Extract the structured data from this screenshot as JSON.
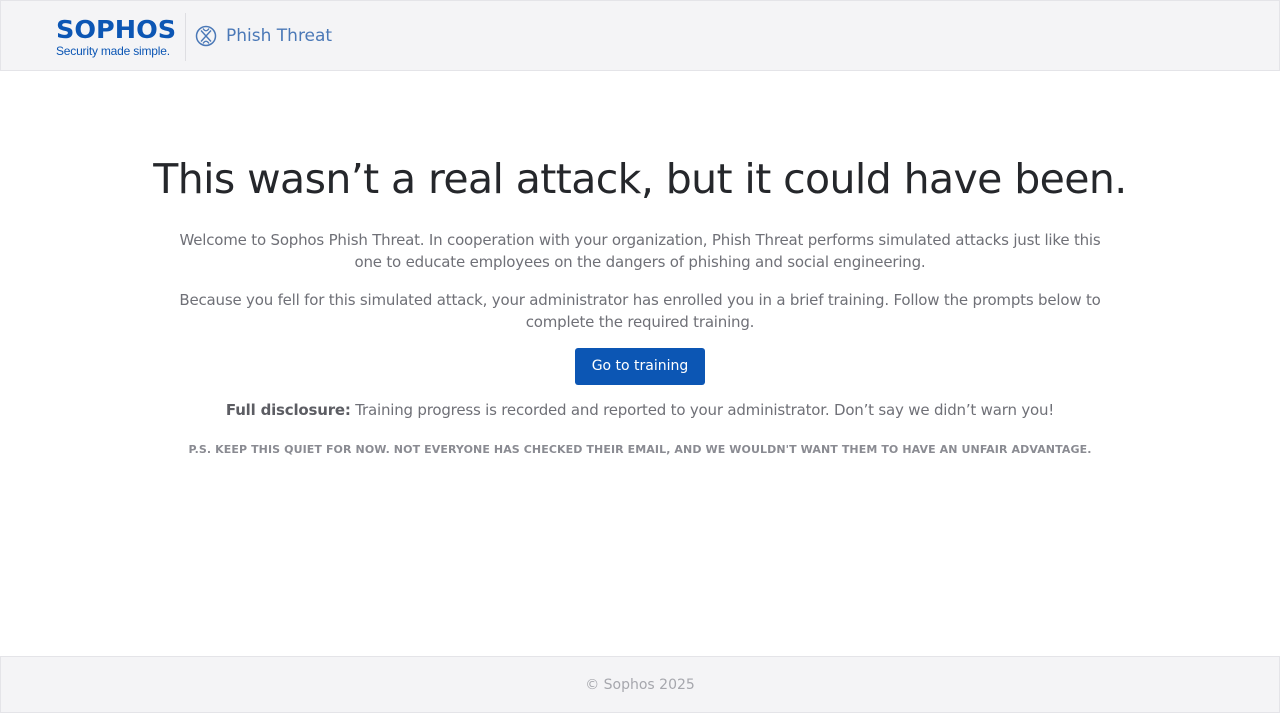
{
  "header": {
    "brand_name": "SOPHOS",
    "brand_tagline": "Security made simple.",
    "product_icon": "phish-threat-icon",
    "product_name": "Phish Threat"
  },
  "main": {
    "headline": "This wasn’t a real attack, but it could have been.",
    "paragraph1": "Welcome to Sophos Phish Threat. In cooperation with your organization, Phish Threat performs simulated attacks just like this one to educate employees on the dangers of phishing and social engineering.",
    "paragraph2": "Because you fell for this simulated attack, your administrator has enrolled you in a brief training. Follow the prompts below to complete the required training.",
    "cta_label": "Go to training",
    "disclosure_label": "Full disclosure:",
    "disclosure_text": " Training progress is recorded and reported to your administrator. Don’t say we didn’t warn you!",
    "ps_text": "P.S. KEEP THIS QUIET FOR NOW. NOT EVERYONE HAS CHECKED THEIR EMAIL, AND WE WOULDN'T WANT THEM TO HAVE AN UNFAIR ADVANTAGE."
  },
  "footer": {
    "copyright": "© Sophos 2025"
  },
  "colors": {
    "brand_blue": "#0c56b4",
    "product_blue": "#4a78b7",
    "header_bg": "#f4f4f6",
    "body_text": "#6f7077",
    "headline_text": "#25272b"
  }
}
